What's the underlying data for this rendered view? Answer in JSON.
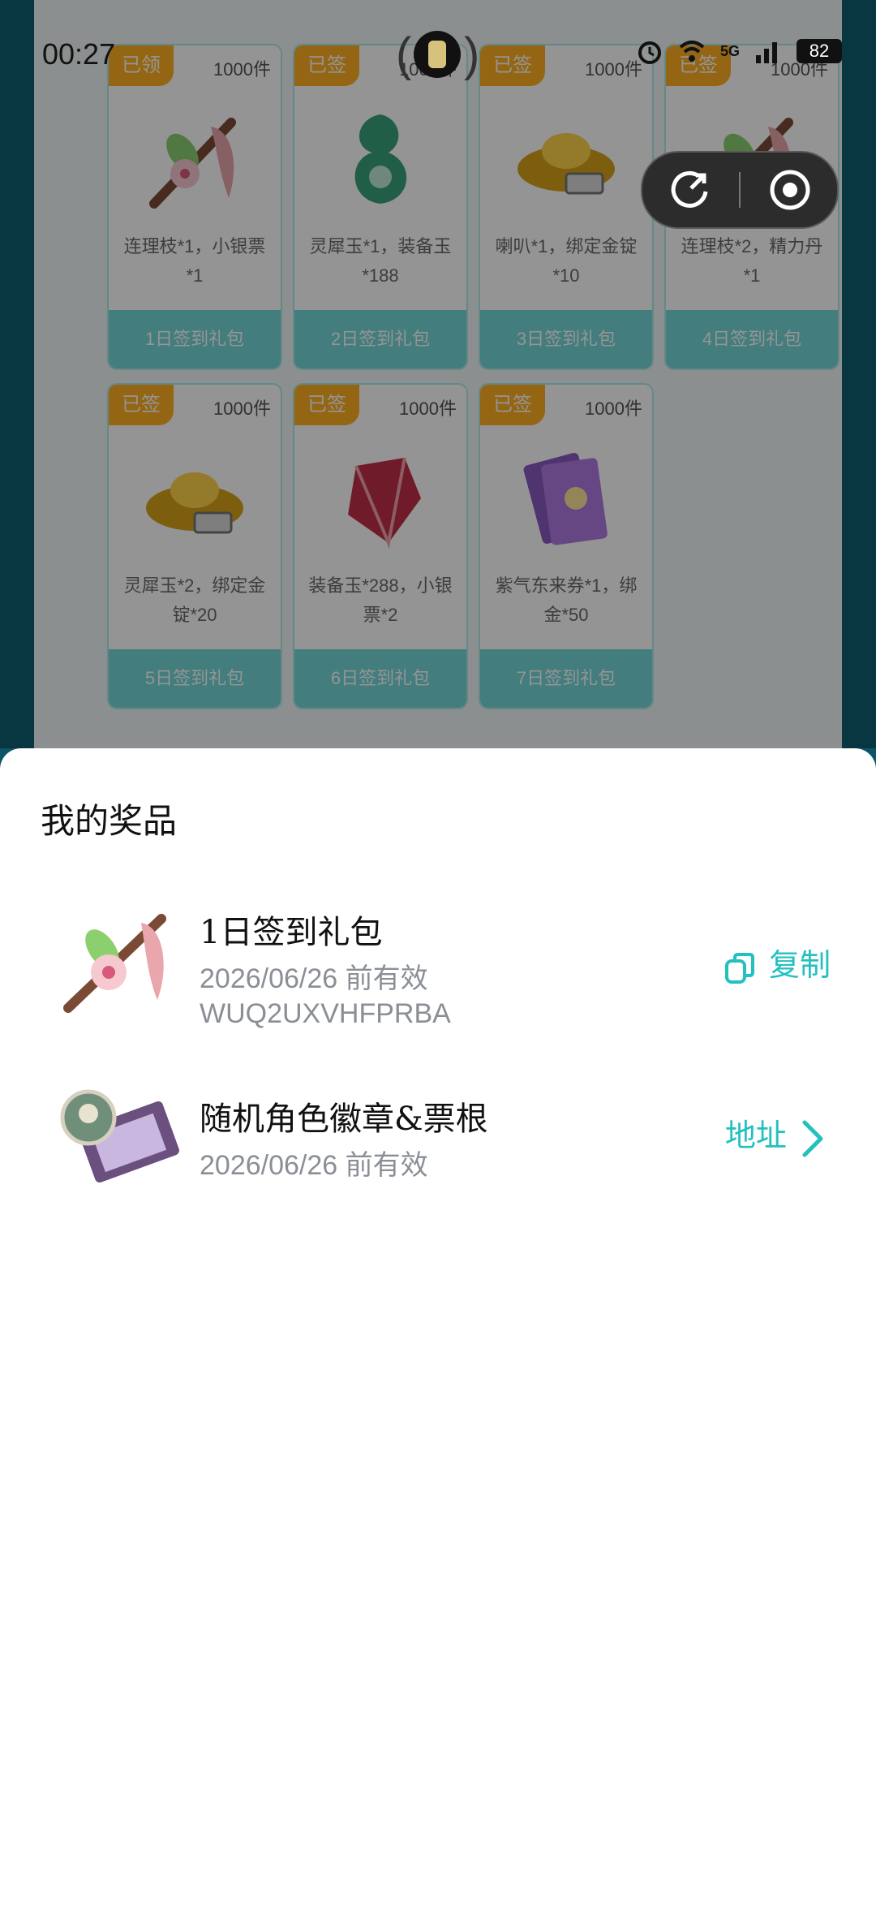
{
  "status_bar": {
    "time": "00:27",
    "battery": "82",
    "network": "5G"
  },
  "rewards": [
    {
      "badge": "已领",
      "stock": "1000件",
      "desc": "连理枝*1，小银票*1",
      "footer": "1日签到礼包",
      "art": "flower-branch"
    },
    {
      "badge": "已签",
      "stock": "1000件",
      "desc": "灵犀玉*1，装备玉*188",
      "footer": "2日签到礼包",
      "art": "jade-pendant"
    },
    {
      "badge": "已签",
      "stock": "1000件",
      "desc": "喇叭*1，绑定金锭*10",
      "footer": "3日签到礼包",
      "art": "gold-ingot"
    },
    {
      "badge": "已签",
      "stock": "1000件",
      "desc": "连理枝*2，精力丹*1",
      "footer": "4日签到礼包",
      "art": "flower-branch"
    },
    {
      "badge": "已签",
      "stock": "1000件",
      "desc": "灵犀玉*2，绑定金锭*20",
      "footer": "5日签到礼包",
      "art": "gold-ingot"
    },
    {
      "badge": "已签",
      "stock": "1000件",
      "desc": "装备玉*288，小银票*2",
      "footer": "6日签到礼包",
      "art": "red-gem"
    },
    {
      "badge": "已签",
      "stock": "1000件",
      "desc": "紫气东来券*1，绑金*50",
      "footer": "7日签到礼包",
      "art": "purple-ticket"
    }
  ],
  "sheet": {
    "title": "我的奖品",
    "prizes": [
      {
        "title": "1日签到礼包",
        "expiry": "2026/06/26 前有效",
        "code": "WUQ2UXVHFPRBA",
        "action": "复制",
        "action_icon": "copy-icon"
      },
      {
        "title": "随机角色徽章&票根",
        "expiry": "2026/06/26 前有效",
        "code": "",
        "action": "地址",
        "action_icon": "chevron-right-icon"
      }
    ]
  },
  "colors": {
    "accent": "#23c0c0",
    "badge": "#ffb022",
    "card_footer": "#74d8d8",
    "frame": "#0e5d70"
  }
}
